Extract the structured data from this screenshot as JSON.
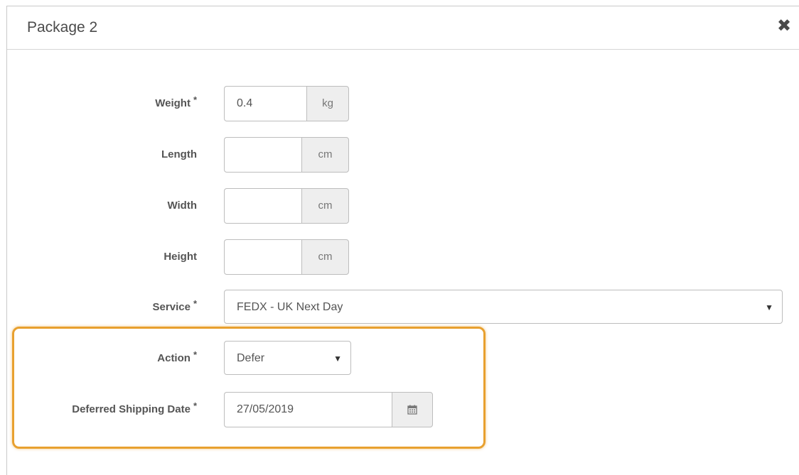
{
  "modal": {
    "title": "Package 2",
    "close_icon": "close-icon"
  },
  "form": {
    "required_mark": "*",
    "weight": {
      "label": "Weight",
      "value": "0.4",
      "unit": "kg"
    },
    "length": {
      "label": "Length",
      "value": "",
      "unit": "cm"
    },
    "width": {
      "label": "Width",
      "value": "",
      "unit": "cm"
    },
    "height": {
      "label": "Height",
      "value": "",
      "unit": "cm"
    },
    "service": {
      "label": "Service",
      "value": "FEDX - UK Next Day"
    },
    "action": {
      "label": "Action",
      "value": "Defer"
    },
    "deferred_date": {
      "label": "Deferred Shipping Date",
      "value": "27/05/2019",
      "icon": "calendar-icon"
    }
  },
  "colors": {
    "highlight": "#e8a02f",
    "addon_bg": "#eeeeee"
  }
}
